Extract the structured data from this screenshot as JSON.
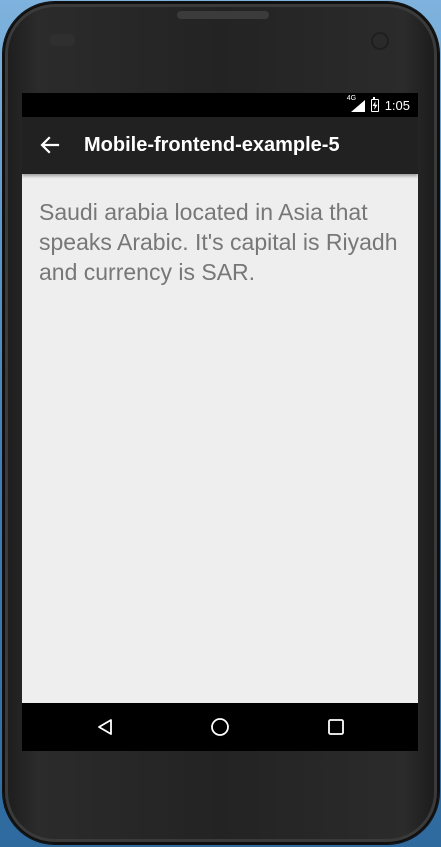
{
  "status_bar": {
    "network": "4G",
    "time": "1:05",
    "icons": [
      "signal-icon",
      "battery-icon"
    ]
  },
  "toolbar": {
    "back_icon": "arrow-left-icon",
    "title": "Mobile-frontend-example-5"
  },
  "content": {
    "text": "Saudi arabia located in Asia that speaks Arabic. It's capital is Riyadh and currency is SAR."
  },
  "nav_bar": {
    "icons": [
      "back-triangle-icon",
      "home-circle-icon",
      "recents-square-icon"
    ]
  },
  "colors": {
    "toolbar": "#212121",
    "screen_background": "#eeeeee",
    "body_text": "#777777",
    "status_bar": "#000000",
    "nav_bar": "#000000"
  }
}
